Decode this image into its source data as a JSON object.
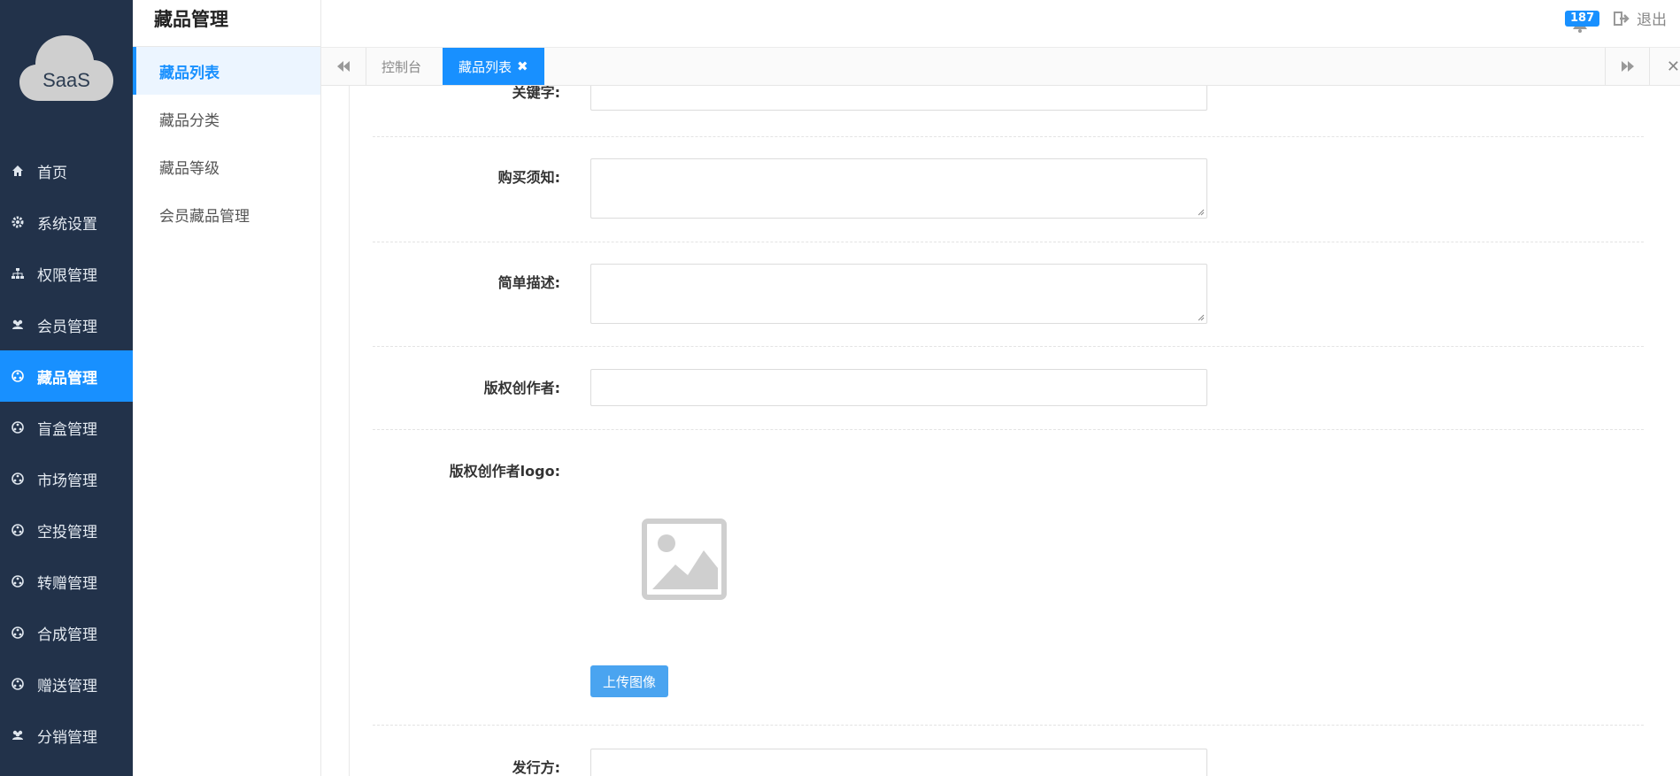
{
  "logo": {
    "text": "SaaS"
  },
  "nav": [
    {
      "label": "首页",
      "icon": "home-icon"
    },
    {
      "label": "系统设置",
      "icon": "gear-icon"
    },
    {
      "label": "权限管理",
      "icon": "sitemap-icon"
    },
    {
      "label": "会员管理",
      "icon": "users-icon"
    },
    {
      "label": "藏品管理",
      "icon": "ball-icon",
      "active": true
    },
    {
      "label": "盲盒管理",
      "icon": "ball-icon"
    },
    {
      "label": "市场管理",
      "icon": "ball-icon"
    },
    {
      "label": "空投管理",
      "icon": "ball-icon"
    },
    {
      "label": "转赠管理",
      "icon": "ball-icon"
    },
    {
      "label": "合成管理",
      "icon": "ball-icon"
    },
    {
      "label": "赠送管理",
      "icon": "ball-icon"
    },
    {
      "label": "分销管理",
      "icon": "users-icon"
    }
  ],
  "subbar": {
    "title": "藏品管理",
    "items": [
      "藏品列表",
      "藏品分类",
      "藏品等级",
      "会员藏品管理"
    ]
  },
  "topbar": {
    "badge": "187",
    "logout": "退出"
  },
  "tabs": {
    "t1": "控制台",
    "t2": "藏品列表",
    "t2_close": "✖",
    "close_all": "✕"
  },
  "form": {
    "keyword_label": "关键字:",
    "notice_label": "购买须知:",
    "desc_label": "简单描述:",
    "author_label": "版权创作者:",
    "author_logo_label": "版权创作者logo:",
    "upload_label": "上传图像",
    "issuer_label": "发行方:"
  },
  "colors": {
    "sidebar": "#22324a",
    "accent": "#1890ff"
  }
}
